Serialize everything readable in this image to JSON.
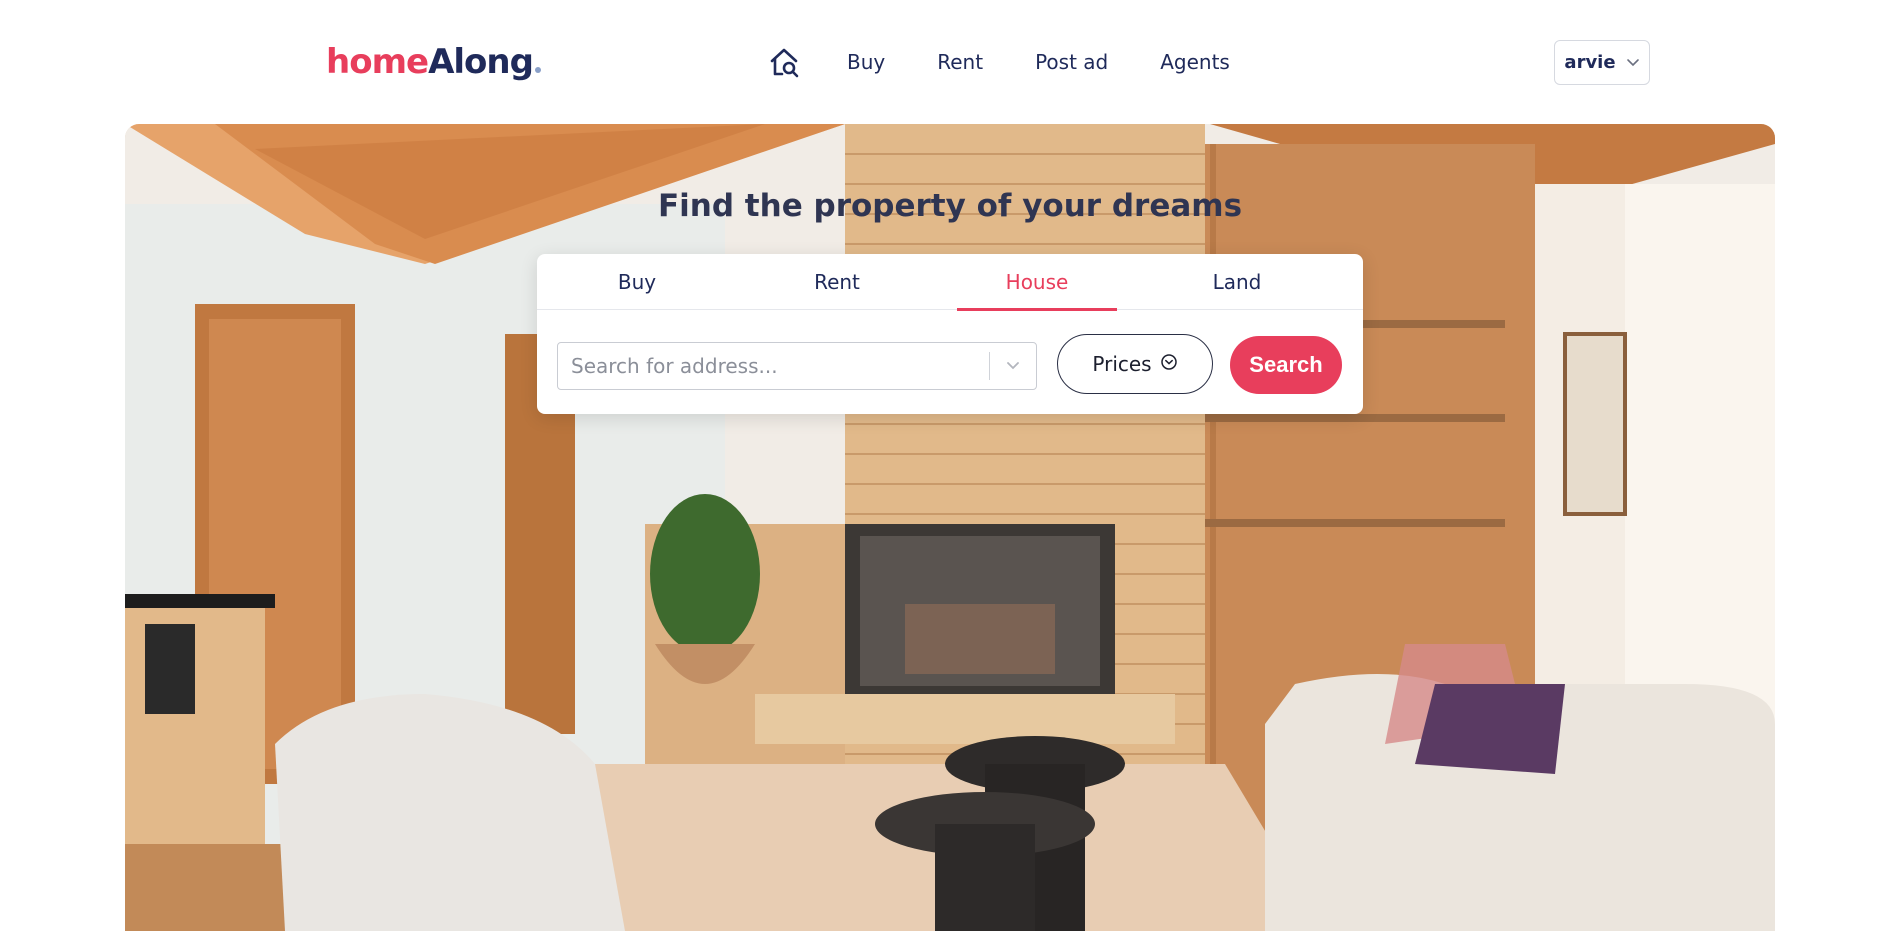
{
  "brand": {
    "logo_part1": "home",
    "logo_part2": "Along",
    "primary_color": "#e83e5c",
    "navy_color": "#1f2a5a"
  },
  "nav": {
    "home_icon": "home-search-icon",
    "items": [
      {
        "label": "Buy"
      },
      {
        "label": "Rent"
      },
      {
        "label": "Post ad"
      },
      {
        "label": "Agents"
      }
    ]
  },
  "user": {
    "name": "arvie",
    "dropdown_icon": "chevron-down-icon"
  },
  "hero": {
    "title": "Find the property of your dreams",
    "background": "living-room-photo"
  },
  "search": {
    "tabs": [
      {
        "label": "Buy",
        "active": false
      },
      {
        "label": "Rent",
        "active": false
      },
      {
        "label": "House",
        "active": true
      },
      {
        "label": "Land",
        "active": false
      }
    ],
    "address_placeholder": "Search for address...",
    "prices_label": "Prices",
    "search_label": "Search"
  }
}
